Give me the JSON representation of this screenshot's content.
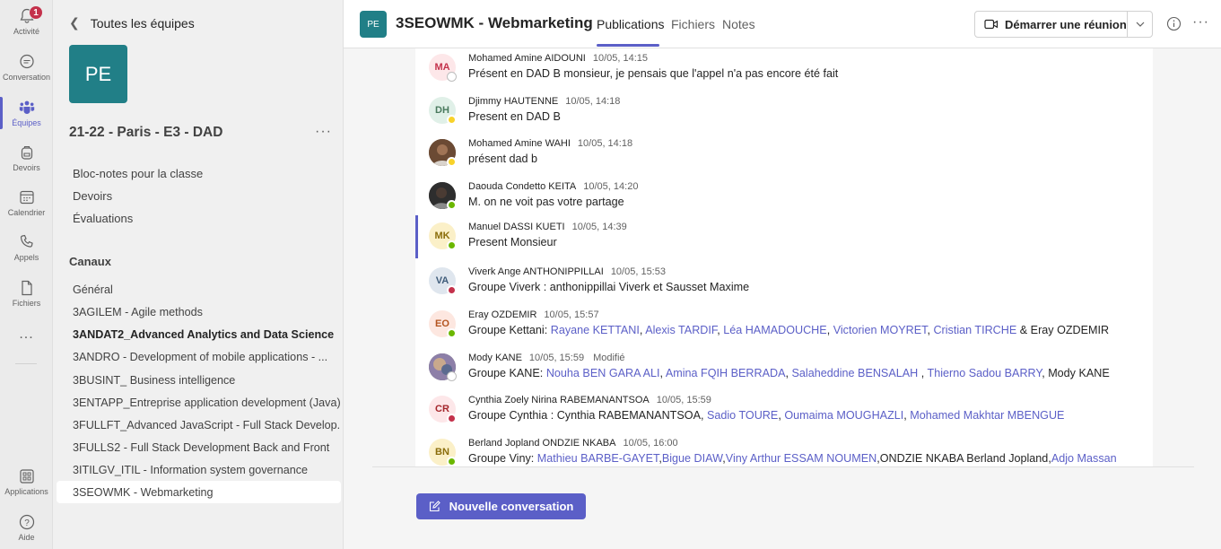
{
  "rail": {
    "activity": "Activité",
    "activity_badge": "1",
    "conversation": "Conversation",
    "teams": "Équipes",
    "assignments": "Devoirs",
    "calendar": "Calendrier",
    "calls": "Appels",
    "files": "Fichiers",
    "more": "...",
    "apps": "Applications",
    "help": "Aide"
  },
  "team_panel": {
    "back_label": "Toutes les équipes",
    "team_avatar": "PE",
    "team_name": "21-22 - Paris - E3 - DAD",
    "more": "···",
    "links": [
      "Bloc-notes pour la classe",
      "Devoirs",
      "Évaluations"
    ],
    "channels_heading": "Canaux",
    "channels": [
      "Général",
      "3AGILEM - Agile methods",
      "3ANDAT2_Advanced Analytics and Data Science",
      "3ANDRO - Development of mobile applications - ...",
      "3BUSINT_ Business intelligence",
      "3ENTAPP_Entreprise application development (Java)",
      "3FULLFT_Advanced JavaScript - Full Stack Develop...",
      "3FULLS2 - Full Stack Development Back and Front",
      "3ITILGV_ITIL - Information system governance",
      "3SEOWMK - Webmarketing"
    ]
  },
  "header": {
    "avatar": "PE",
    "title": "3SEOWMK - Webmarketing",
    "tabs": [
      "Publications",
      "Fichiers",
      "Notes"
    ],
    "meet_label": "Démarrer une réunion",
    "more": "···"
  },
  "messages": [
    {
      "initials": "MA",
      "author": "Mohamed Amine AIDOUNI",
      "time": "10/05, 14:15",
      "edited": "",
      "text": "Présent en DAD B monsieur, je pensais que l'appel n'a pas encore été fait"
    },
    {
      "initials": "DH",
      "author": "Djimmy HAUTENNE",
      "time": "10/05, 14:18",
      "edited": "",
      "text": "Present en DAD B"
    },
    {
      "initials": "",
      "author": "Mohamed Amine WAHI",
      "time": "10/05, 14:18",
      "edited": "",
      "text": "présent dad b"
    },
    {
      "initials": "",
      "author": "Daouda Condetto KEITA",
      "time": "10/05, 14:20",
      "edited": "",
      "text": "M. on ne voit pas votre partage"
    },
    {
      "initials": "MK",
      "author": "Manuel DASSI KUETI",
      "time": "10/05, 14:39",
      "edited": "",
      "text": "Present Monsieur"
    },
    {
      "initials": "VA",
      "author": "Viverk Ange ANTHONIPPILLAI",
      "time": "10/05, 15:53",
      "edited": "",
      "text": "Groupe Viverk : anthonippillai Viverk et Sausset Maxime"
    },
    {
      "initials": "EO",
      "author": "Eray OZDEMIR",
      "time": "10/05, 15:57",
      "edited": "",
      "text_prefix": "Groupe Kettani: ",
      "mentions": [
        "Rayane KETTANI",
        "Alexis TARDIF",
        "Léa HAMADOUCHE",
        "Victorien MOYRET",
        "Cristian TIRCHE"
      ],
      "text_suffix": "& Eray OZDEMIR"
    },
    {
      "initials": "",
      "author": "Mody KANE",
      "time": "10/05, 15:59",
      "edited": "Modifié",
      "text_prefix": "Groupe KANE: ",
      "mentions": [
        "Nouha BEN GARA ALI",
        "Amina FQIH BERRADA",
        "Salaheddine BENSALAH",
        "Thierno Sadou BARRY"
      ],
      "text_suffix": "Mody KANE"
    },
    {
      "initials": "CR",
      "author": "Cynthia Zoely Nirina RABEMANANTSOA",
      "time": "10/05, 15:59",
      "edited": "",
      "text_prefix": "Groupe Cynthia : Cynthia RABEMANANTSOA, ",
      "mentions": [
        "Sadio TOURE",
        "Oumaima MOUGHAZLI",
        "Mohamed Makhtar MBENGUE"
      ],
      "text_suffix": ""
    },
    {
      "initials": "BN",
      "author": "Berland Jopland ONDZIE NKABA",
      "time": "10/05, 16:00",
      "edited": "",
      "text_prefix": "Groupe Viny: ",
      "mentions": [
        "Mathieu BARBE-GAYET",
        "Bigue DIAW",
        "Viny Arthur ESSAM NOUMEN"
      ],
      "text_middle": "ONDZIE NKABA Berland Jopland,",
      "mention_end": "Adjo Massan"
    }
  ],
  "new_conversation": "Nouvelle conversation",
  "colors": {
    "accent": "#5b5fc7",
    "team": "#217f87",
    "available": "#6bb700",
    "busy": "#c4314b",
    "away": "#f8d22a"
  }
}
